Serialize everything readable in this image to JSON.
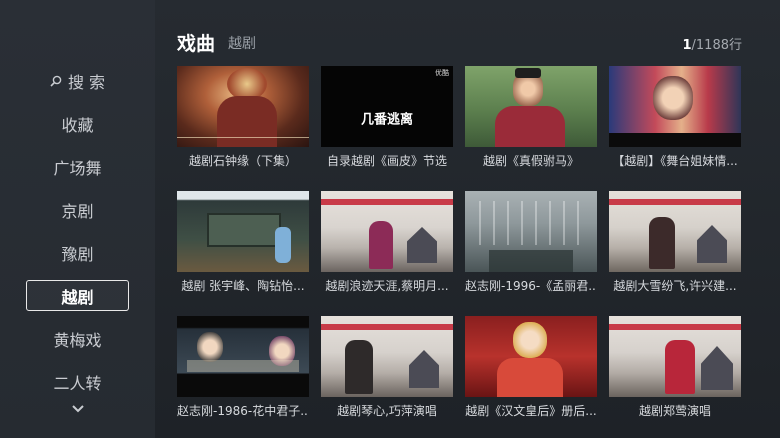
{
  "sidebar": {
    "search_label": "搜 索",
    "items": [
      {
        "label": "收藏"
      },
      {
        "label": "广场舞"
      },
      {
        "label": "京剧"
      },
      {
        "label": "豫剧"
      },
      {
        "label": "越剧"
      },
      {
        "label": "黄梅戏"
      },
      {
        "label": "二人转"
      }
    ],
    "active": "越剧"
  },
  "header": {
    "title": "戏曲",
    "subtitle": "越剧",
    "page_current": "1",
    "page_rest": "/1188行"
  },
  "videos": [
    {
      "caption": "越剧石钟缘（下集）"
    },
    {
      "caption": "自录越剧《画皮》节选",
      "thumb_text": "几番逃离",
      "thumb_tag": "优酷"
    },
    {
      "caption": "越剧《真假驸马》"
    },
    {
      "caption": "【越剧】《舞台姐妹情..."
    },
    {
      "caption": "越剧 张宇峰、陶钻怡..."
    },
    {
      "caption": "越剧浪迹天涯,蔡明月..."
    },
    {
      "caption": "赵志刚-1996-《孟丽君..."
    },
    {
      "caption": "越剧大雪纷飞,许兴建..."
    },
    {
      "caption": "赵志刚-1986-花中君子..."
    },
    {
      "caption": "越剧琴心,巧萍演唱"
    },
    {
      "caption": "越剧《汉文皇后》册后..."
    },
    {
      "caption": "越剧郑莺演唱"
    }
  ]
}
